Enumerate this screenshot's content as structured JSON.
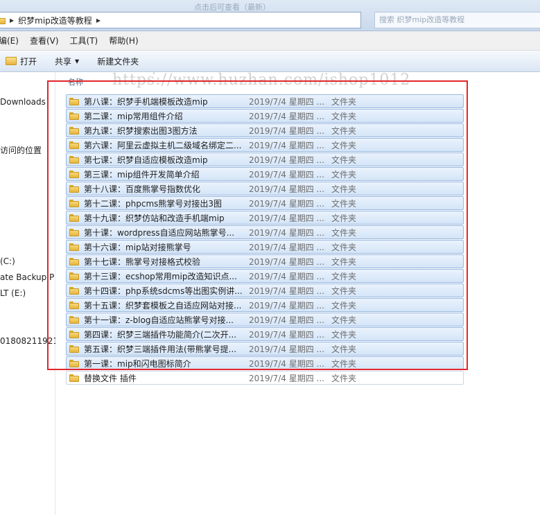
{
  "window": {
    "address_path": "织梦mip改造等教程",
    "top_faint_left": "点击后可查看（最新）",
    "top_faint_right": "搜索 织梦mip改造等教程"
  },
  "menu": [
    "编(E)",
    "查看(V)",
    "工具(T)",
    "帮助(H)"
  ],
  "toolbar": {
    "open": "打开",
    "share": "共享",
    "new_folder": "新建文件夹"
  },
  "nav": {
    "items": [
      "Downloads",
      "访问的位置",
      "(C:)",
      "ate Backup P",
      "LT (E:)",
      "01808211921"
    ]
  },
  "list": {
    "column_name": "名称",
    "rows": [
      {
        "name": "第八课：织梦手机端模板改造mip",
        "date": "2019/7/4 星期四 ...",
        "type": "文件夹"
      },
      {
        "name": "第二课：mip常用组件介绍",
        "date": "2019/7/4 星期四 ...",
        "type": "文件夹"
      },
      {
        "name": "第九课：织梦搜索出图3图方法",
        "date": "2019/7/4 星期四 ...",
        "type": "文件夹"
      },
      {
        "name": "第六课：阿里云虚拟主机二级域名绑定二...",
        "date": "2019/7/4 星期四 ...",
        "type": "文件夹"
      },
      {
        "name": "第七课：织梦自适应模板改造mip",
        "date": "2019/7/4 星期四 ...",
        "type": "文件夹"
      },
      {
        "name": "第三课：mip组件开发简单介绍",
        "date": "2019/7/4 星期四 ...",
        "type": "文件夹"
      },
      {
        "name": "第十八课：百度熊掌号指数优化",
        "date": "2019/7/4 星期四 ...",
        "type": "文件夹"
      },
      {
        "name": "第十二课：phpcms熊掌号对接出3图",
        "date": "2019/7/4 星期四 ...",
        "type": "文件夹"
      },
      {
        "name": "第十九课：织梦仿站和改造手机端mip",
        "date": "2019/7/4 星期四 ...",
        "type": "文件夹"
      },
      {
        "name": "第十课：wordpress自适应网站熊掌号...",
        "date": "2019/7/4 星期四 ...",
        "type": "文件夹"
      },
      {
        "name": "第十六课：mip站对接熊掌号",
        "date": "2019/7/4 星期四 ...",
        "type": "文件夹"
      },
      {
        "name": "第十七课：熊掌号对接格式校验",
        "date": "2019/7/4 星期四 ...",
        "type": "文件夹"
      },
      {
        "name": "第十三课：ecshop常用mip改造知识点...",
        "date": "2019/7/4 星期四 ...",
        "type": "文件夹"
      },
      {
        "name": "第十四课：php系统sdcms等出图实例讲...",
        "date": "2019/7/4 星期四 ...",
        "type": "文件夹"
      },
      {
        "name": "第十五课：织梦套模板之自适应网站对接...",
        "date": "2019/7/4 星期四 ...",
        "type": "文件夹"
      },
      {
        "name": "第十一课：z-blog自适应站熊掌号对接...",
        "date": "2019/7/4 星期四 ...",
        "type": "文件夹"
      },
      {
        "name": "第四课：织梦三端插件功能简介(二次开...",
        "date": "2019/7/4 星期四 ...",
        "type": "文件夹"
      },
      {
        "name": "第五课：织梦三端插件用法(带熊掌号提...",
        "date": "2019/7/4 星期四 ...",
        "type": "文件夹"
      },
      {
        "name": "第一课：mip和闪电图标简介",
        "date": "2019/7/4 星期四 ...",
        "type": "文件夹"
      },
      {
        "name": "替换文件 插件",
        "date": "2019/7/4 星期四 ...",
        "type": "文件夹"
      }
    ]
  },
  "watermark": "https://www.huzhan.com/ishop1012",
  "colors": {
    "selection": "#d4e5f8",
    "highlight_box": "#e0262b"
  }
}
